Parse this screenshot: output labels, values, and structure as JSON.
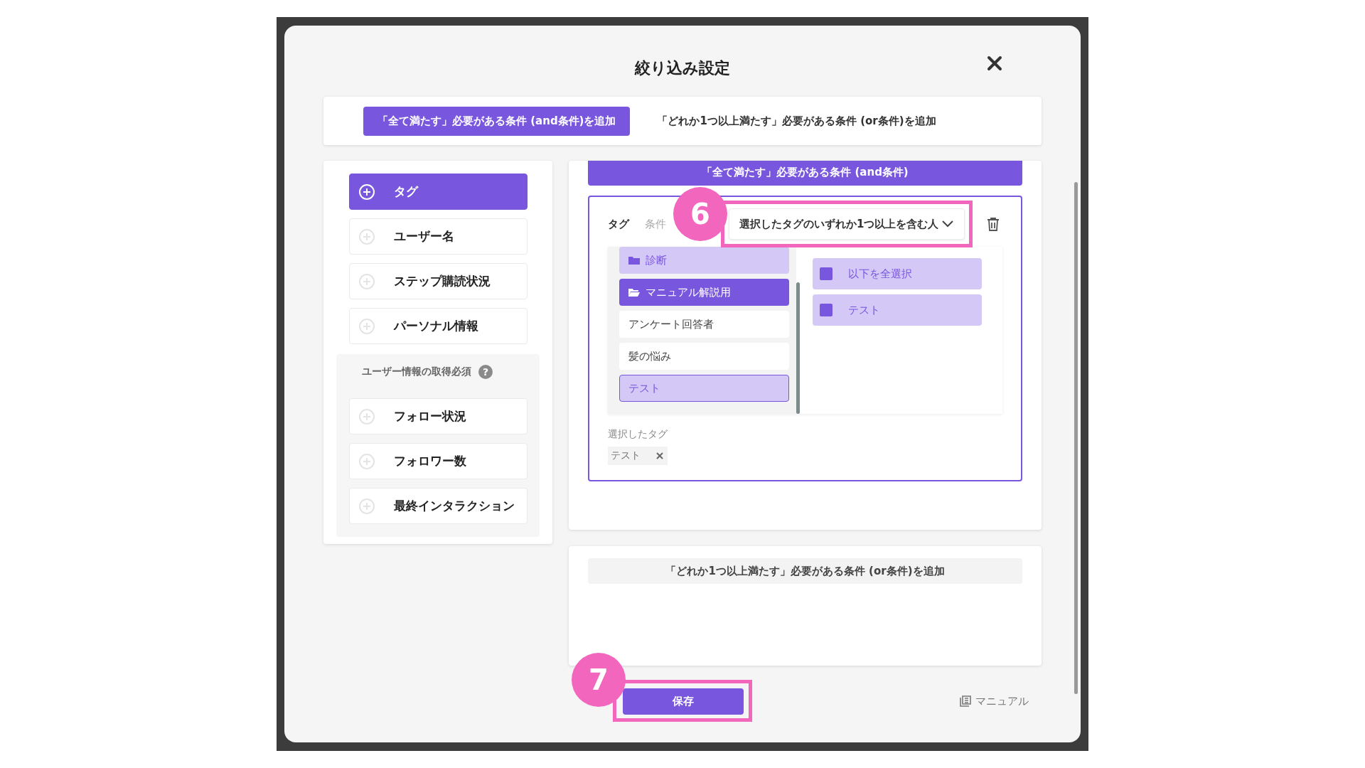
{
  "dialog": {
    "title": "絞り込み設定"
  },
  "mode_tabs": [
    {
      "label": "「全て満たす」必要がある条件 (and条件)を追加",
      "selected": true
    },
    {
      "label": "「どれか1つ以上満たす」必要がある条件 (or条件)を追加",
      "selected": false
    }
  ],
  "categories": [
    {
      "label": "タグ",
      "selected": true
    },
    {
      "label": "ユーザー名",
      "selected": false
    },
    {
      "label": "ステップ購読状況",
      "selected": false
    },
    {
      "label": "パーソナル情報",
      "selected": false
    }
  ],
  "required_group": {
    "title": "ユーザー情報の取得必須",
    "help_symbol": "?",
    "items": [
      {
        "label": "フォロー状況",
        "selected": false
      },
      {
        "label": "フォロワー数",
        "selected": false
      },
      {
        "label": "最終インタラクション",
        "selected": false
      }
    ]
  },
  "and_section": {
    "header": "「全て満たす」必要がある条件 (and条件)",
    "condition": {
      "tag_label": "タグ",
      "condition_label": "条件",
      "condition_value": "選択したタグのいずれか1つ以上を含む人",
      "annotation": "6",
      "tree": [
        {
          "label": "診断",
          "kind": "folder",
          "selected": false
        },
        {
          "label": "マニュアル解説用",
          "kind": "folder",
          "selected": true
        },
        {
          "label": "アンケート回答者",
          "kind": "tag",
          "selected": false
        },
        {
          "label": "髪の悩み",
          "kind": "tag",
          "selected": false
        },
        {
          "label": "テスト",
          "kind": "tag",
          "selected": true
        }
      ],
      "options": [
        {
          "label": "以下を全選択",
          "checked": true
        },
        {
          "label": "テスト",
          "checked": true
        }
      ],
      "selected_label": "選択したタグ",
      "selected_tags": [
        {
          "label": "テスト"
        }
      ]
    }
  },
  "or_section": {
    "button": "「どれか1つ以上満たす」必要がある条件 (or条件)を追加"
  },
  "footer": {
    "save": "保存",
    "annotation": "7",
    "manual_link": "マニュアル"
  }
}
